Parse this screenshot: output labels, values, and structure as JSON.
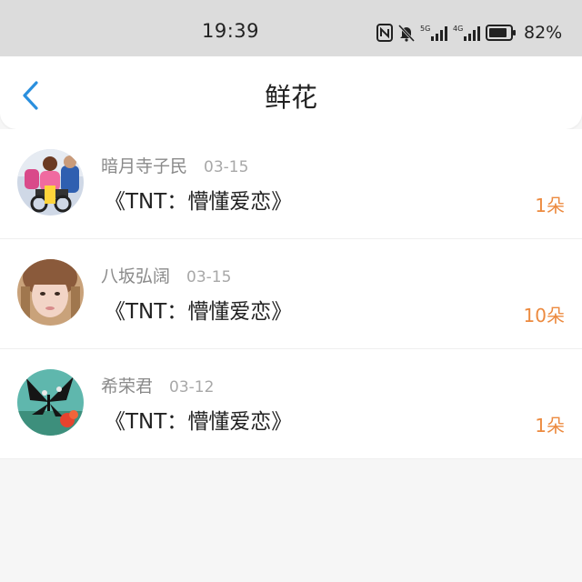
{
  "status_bar": {
    "time": "19:39",
    "battery_percent": "82%",
    "signal_1_label": "5G",
    "signal_2_label": "4G",
    "icons": [
      "nfc-icon",
      "mute-icon",
      "signal-5g-icon",
      "signal-4g-icon",
      "battery-icon"
    ]
  },
  "header": {
    "title": "鲜花",
    "back_icon": "chevron-left-icon",
    "accent_color": "#2a8fde"
  },
  "list": {
    "items": [
      {
        "user": "暗月寺子民",
        "date": "03-15",
        "gift": "《TNT：懵懂爱恋》",
        "count": "1朵"
      },
      {
        "user": "八坂弘阔",
        "date": "03-15",
        "gift": "《TNT：懵懂爱恋》",
        "count": "10朵"
      },
      {
        "user": "希荣君",
        "date": "03-12",
        "gift": "《TNT：懵懂爱恋》",
        "count": "1朵"
      }
    ]
  },
  "colors": {
    "count": "#ec8a3f",
    "status_bar_bg": "#dcdcdc",
    "page_bg": "#f6f6f6"
  }
}
